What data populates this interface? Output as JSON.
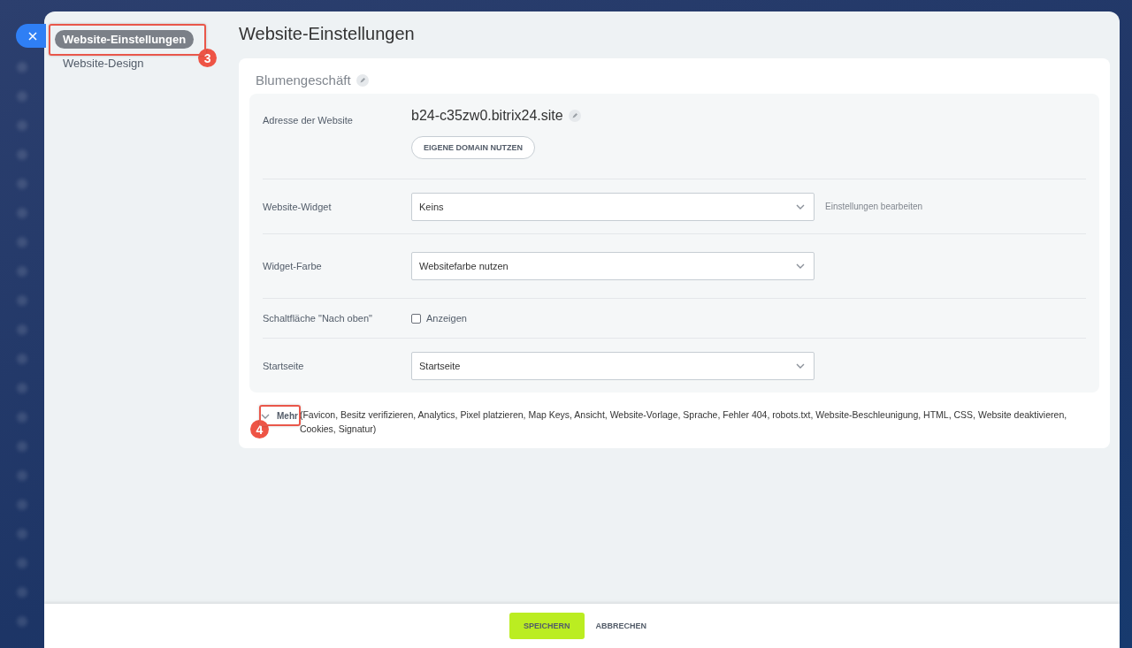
{
  "nav": {
    "items": [
      {
        "label": "Website-Einstellungen",
        "selected": true,
        "callout": "3"
      },
      {
        "label": "Website-Design",
        "selected": false
      }
    ]
  },
  "title": "Website-Einstellungen",
  "card": {
    "name": "Blumengeschäft",
    "rows": [
      {
        "kind": "address",
        "label": "Adresse der Website",
        "value": "b24-c35zw0.bitrix24.site",
        "button": "EIGENE DOMAIN NUTZEN"
      },
      {
        "kind": "select",
        "label": "Website-Widget",
        "value": "Keins",
        "link": "Einstellungen bearbeiten"
      },
      {
        "kind": "select",
        "label": "Widget-Farbe",
        "value": "Websitefarbe nutzen"
      },
      {
        "kind": "checkbox",
        "label": "Schaltfläche \"Nach oben\"",
        "option": "Anzeigen",
        "checked": false
      },
      {
        "kind": "select",
        "label": "Startseite",
        "value": "Startseite"
      }
    ],
    "more": {
      "label": "Mehr",
      "expanded": false,
      "callout": "4",
      "list": "(Favicon,  Besitz verifizieren,  Analytics,  Pixel platzieren,  Map Keys,  Ansicht,  Website-Vorlage,  Sprache,  Fehler 404,  robots.txt,  Website-Beschleunigung,  HTML,  CSS,  Website deaktivieren,  Cookies,  Signatur)"
    }
  },
  "footer": {
    "save": "SPEICHERN",
    "cancel": "ABBRECHEN"
  }
}
